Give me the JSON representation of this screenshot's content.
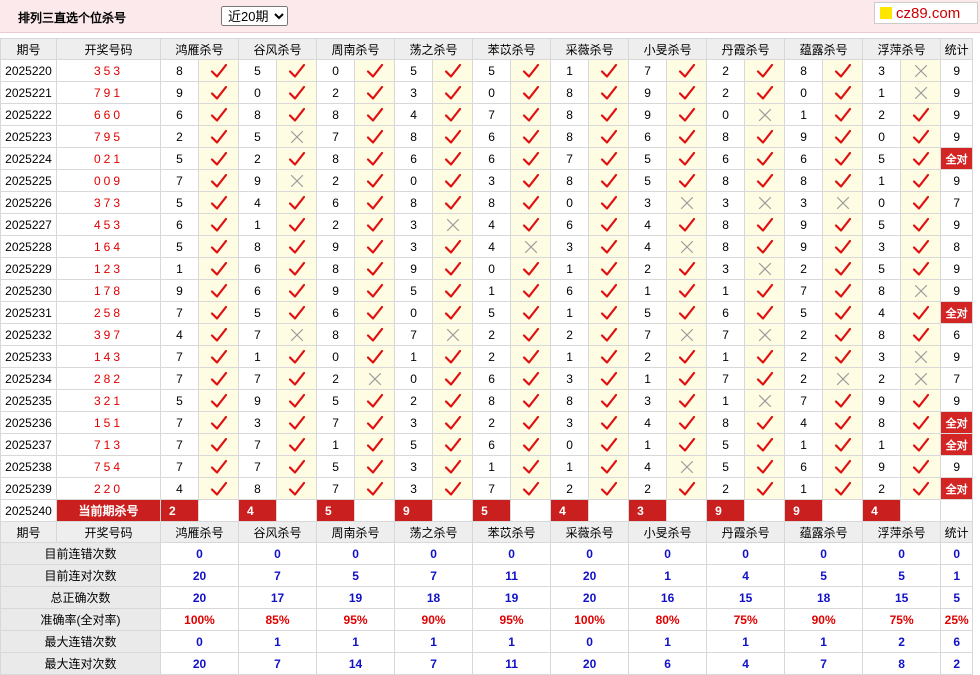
{
  "header": {
    "title": "排列三直选个位杀号",
    "period_select": {
      "value": "近20期",
      "options": [
        "近20期"
      ]
    },
    "logo_text": "cz89.com"
  },
  "table": {
    "period_header": "期号",
    "draw_header": "开奖号码",
    "count_header": "统计",
    "experts": [
      "鸿雁杀号",
      "谷风杀号",
      "周南杀号",
      "荡之杀号",
      "苯苡杀号",
      "采薇杀号",
      "小旻杀号",
      "丹霞杀号",
      "蕴露杀号",
      "浮萍杀号"
    ],
    "rows": [
      {
        "period": "2025220",
        "draw": "353",
        "nums": [
          8,
          5,
          0,
          5,
          5,
          1,
          7,
          2,
          8,
          3
        ],
        "ok": [
          1,
          1,
          1,
          1,
          1,
          1,
          1,
          1,
          1,
          0
        ],
        "count": "9"
      },
      {
        "period": "2025221",
        "draw": "791",
        "nums": [
          9,
          0,
          2,
          3,
          0,
          8,
          9,
          2,
          0,
          1
        ],
        "ok": [
          1,
          1,
          1,
          1,
          1,
          1,
          1,
          1,
          1,
          0
        ],
        "count": "9"
      },
      {
        "period": "2025222",
        "draw": "660",
        "nums": [
          6,
          8,
          8,
          4,
          7,
          8,
          9,
          0,
          1,
          2
        ],
        "ok": [
          1,
          1,
          1,
          1,
          1,
          1,
          1,
          0,
          1,
          1
        ],
        "count": "9"
      },
      {
        "period": "2025223",
        "draw": "795",
        "nums": [
          2,
          5,
          7,
          8,
          6,
          8,
          6,
          8,
          9,
          0
        ],
        "ok": [
          1,
          0,
          1,
          1,
          1,
          1,
          1,
          1,
          1,
          1
        ],
        "count": "9"
      },
      {
        "period": "2025224",
        "draw": "021",
        "nums": [
          5,
          2,
          8,
          6,
          6,
          7,
          5,
          6,
          6,
          5
        ],
        "ok": [
          1,
          1,
          1,
          1,
          1,
          1,
          1,
          1,
          1,
          1
        ],
        "count": "全对"
      },
      {
        "period": "2025225",
        "draw": "009",
        "nums": [
          7,
          9,
          2,
          0,
          3,
          8,
          5,
          8,
          8,
          1
        ],
        "ok": [
          1,
          0,
          1,
          1,
          1,
          1,
          1,
          1,
          1,
          1
        ],
        "count": "9"
      },
      {
        "period": "2025226",
        "draw": "373",
        "nums": [
          5,
          4,
          6,
          8,
          8,
          0,
          3,
          3,
          3,
          0
        ],
        "ok": [
          1,
          1,
          1,
          1,
          1,
          1,
          0,
          0,
          0,
          1
        ],
        "count": "7"
      },
      {
        "period": "2025227",
        "draw": "453",
        "nums": [
          6,
          1,
          2,
          3,
          4,
          6,
          4,
          8,
          9,
          5
        ],
        "ok": [
          1,
          1,
          1,
          0,
          1,
          1,
          1,
          1,
          1,
          1
        ],
        "count": "9"
      },
      {
        "period": "2025228",
        "draw": "164",
        "nums": [
          5,
          8,
          9,
          3,
          4,
          3,
          4,
          8,
          9,
          3
        ],
        "ok": [
          1,
          1,
          1,
          1,
          0,
          1,
          0,
          1,
          1,
          1
        ],
        "count": "8"
      },
      {
        "period": "2025229",
        "draw": "123",
        "nums": [
          1,
          6,
          8,
          9,
          0,
          1,
          2,
          3,
          2,
          5
        ],
        "ok": [
          1,
          1,
          1,
          1,
          1,
          1,
          1,
          0,
          1,
          1
        ],
        "count": "9"
      },
      {
        "period": "2025230",
        "draw": "178",
        "nums": [
          9,
          6,
          9,
          5,
          1,
          6,
          1,
          1,
          7,
          8
        ],
        "ok": [
          1,
          1,
          1,
          1,
          1,
          1,
          1,
          1,
          1,
          0
        ],
        "count": "9"
      },
      {
        "period": "2025231",
        "draw": "258",
        "nums": [
          7,
          5,
          6,
          0,
          5,
          1,
          5,
          6,
          5,
          4
        ],
        "ok": [
          1,
          1,
          1,
          1,
          1,
          1,
          1,
          1,
          1,
          1
        ],
        "count": "全对"
      },
      {
        "period": "2025232",
        "draw": "397",
        "nums": [
          4,
          7,
          8,
          7,
          2,
          2,
          7,
          7,
          2,
          8
        ],
        "ok": [
          1,
          0,
          1,
          0,
          1,
          1,
          0,
          0,
          1,
          1
        ],
        "count": "6"
      },
      {
        "period": "2025233",
        "draw": "143",
        "nums": [
          7,
          1,
          0,
          1,
          2,
          1,
          2,
          1,
          2,
          3
        ],
        "ok": [
          1,
          1,
          1,
          1,
          1,
          1,
          1,
          1,
          1,
          0
        ],
        "count": "9"
      },
      {
        "period": "2025234",
        "draw": "282",
        "nums": [
          7,
          7,
          2,
          0,
          6,
          3,
          1,
          7,
          2,
          2
        ],
        "ok": [
          1,
          1,
          0,
          1,
          1,
          1,
          1,
          1,
          0,
          0
        ],
        "count": "7"
      },
      {
        "period": "2025235",
        "draw": "321",
        "nums": [
          5,
          9,
          5,
          2,
          8,
          8,
          3,
          1,
          7,
          9
        ],
        "ok": [
          1,
          1,
          1,
          1,
          1,
          1,
          1,
          0,
          1,
          1
        ],
        "count": "9"
      },
      {
        "period": "2025236",
        "draw": "151",
        "nums": [
          7,
          3,
          7,
          3,
          2,
          3,
          4,
          8,
          4,
          8
        ],
        "ok": [
          1,
          1,
          1,
          1,
          1,
          1,
          1,
          1,
          1,
          1
        ],
        "count": "全对"
      },
      {
        "period": "2025237",
        "draw": "713",
        "nums": [
          7,
          7,
          1,
          5,
          6,
          0,
          1,
          5,
          1,
          1
        ],
        "ok": [
          1,
          1,
          1,
          1,
          1,
          1,
          1,
          1,
          1,
          1
        ],
        "count": "全对"
      },
      {
        "period": "2025238",
        "draw": "754",
        "nums": [
          7,
          7,
          5,
          3,
          1,
          1,
          4,
          5,
          6,
          9
        ],
        "ok": [
          1,
          1,
          1,
          1,
          1,
          1,
          0,
          1,
          1,
          1
        ],
        "count": "9"
      },
      {
        "period": "2025239",
        "draw": "220",
        "nums": [
          4,
          8,
          7,
          3,
          7,
          2,
          2,
          2,
          1,
          2
        ],
        "ok": [
          1,
          1,
          1,
          1,
          1,
          1,
          1,
          1,
          1,
          1
        ],
        "count": "全对"
      }
    ],
    "current": {
      "period": "2025240",
      "label": "当前期杀号",
      "kills": [
        "2",
        "4",
        "5",
        "9",
        "5",
        "4",
        "3",
        "9",
        "9",
        "4"
      ]
    },
    "stats": [
      {
        "label": "目前连错次数",
        "values": [
          "0",
          "0",
          "0",
          "0",
          "0",
          "0",
          "0",
          "0",
          "0",
          "0"
        ],
        "total": "0"
      },
      {
        "label": "目前连对次数",
        "values": [
          "20",
          "7",
          "5",
          "7",
          "11",
          "20",
          "1",
          "4",
          "5",
          "5"
        ],
        "total": "1"
      },
      {
        "label": "总正确次数",
        "values": [
          "20",
          "17",
          "19",
          "18",
          "19",
          "20",
          "16",
          "15",
          "18",
          "15"
        ],
        "total": "5"
      },
      {
        "label": "准确率(全对率)",
        "values": [
          "100%",
          "85%",
          "95%",
          "90%",
          "95%",
          "100%",
          "80%",
          "75%",
          "90%",
          "75%"
        ],
        "total": "25%",
        "red": true
      },
      {
        "label": "最大连错次数",
        "values": [
          "0",
          "1",
          "1",
          "1",
          "1",
          "0",
          "1",
          "1",
          "1",
          "2"
        ],
        "total": "6"
      },
      {
        "label": "最大连对次数",
        "values": [
          "20",
          "7",
          "14",
          "7",
          "11",
          "20",
          "6",
          "4",
          "7",
          "8"
        ],
        "total": "2"
      }
    ]
  },
  "colors": {
    "check": "#e01010",
    "cross": "#9a9a9a",
    "highlight": "#d42525",
    "stat_blue": "#1010c8"
  }
}
